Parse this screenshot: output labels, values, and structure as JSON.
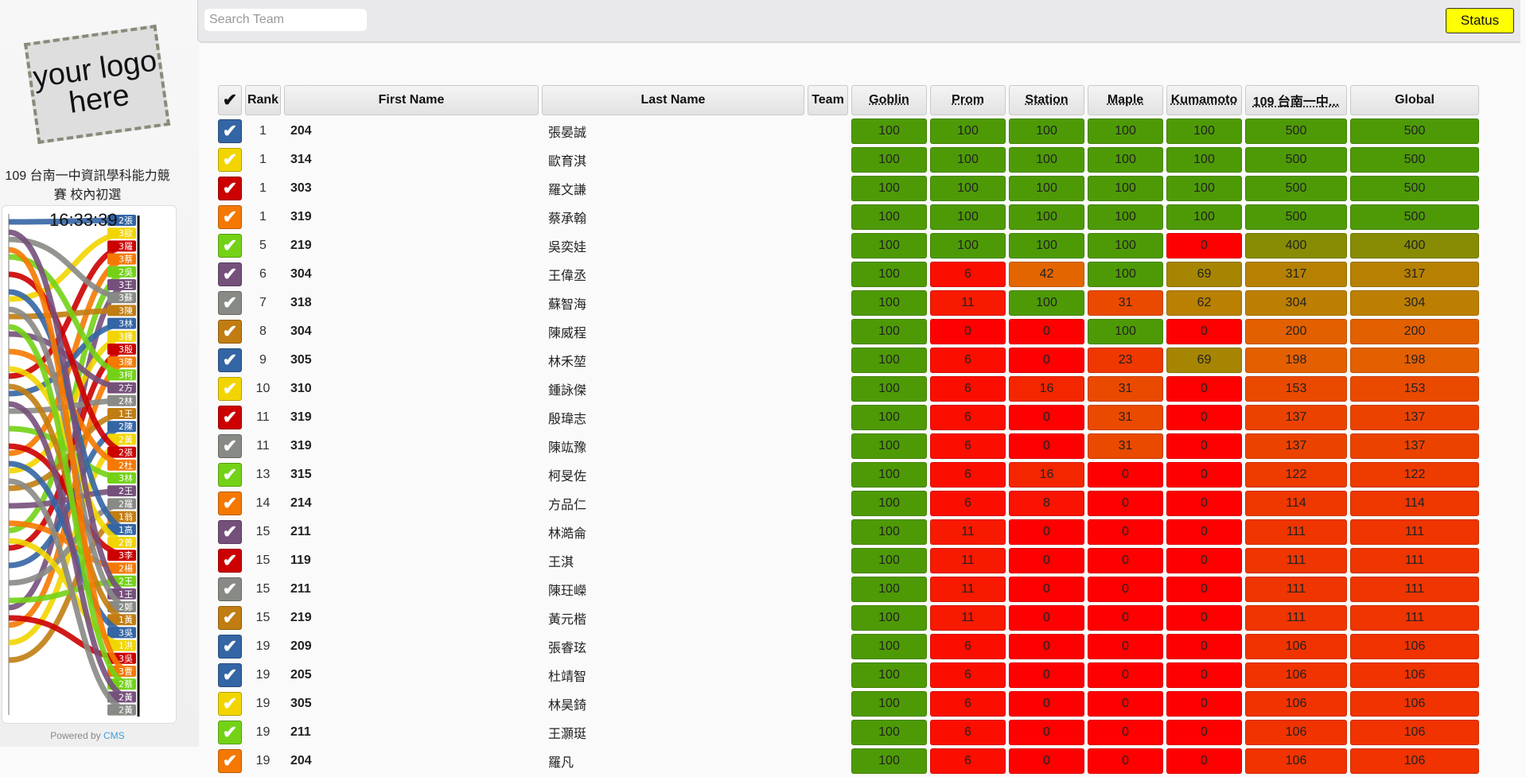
{
  "sidebar": {
    "logo_text": "your logo here",
    "contest_title": "109 台南一中資訊學科能力競賽 校內初選",
    "clock": "16:33:39",
    "powered_by": "Powered by",
    "powered_link": "CMS",
    "rank_chart_labels": [
      "2張",
      "3歐",
      "3羅",
      "3蔡",
      "2吳",
      "3王",
      "3蘇",
      "3陳",
      "3林",
      "3鍾",
      "3殷",
      "3陳",
      "3柯",
      "2方",
      "2林",
      "1王",
      "2陳",
      "2黃",
      "2張",
      "2杜",
      "3林",
      "2王",
      "2羅",
      "1翁",
      "1高",
      "2曾",
      "3李",
      "2楊",
      "2王",
      "1王",
      "2鄭",
      "1黃",
      "3吳",
      "1洪",
      "3吳",
      "3曹",
      "2蔡",
      "2黃",
      "2黃"
    ]
  },
  "topbar": {
    "search_placeholder": "Search Team",
    "status_label": "Status"
  },
  "colors": {
    "green": "#4e9a06",
    "red": "#ff0000",
    "status_yellow": "#ffff00",
    "team_colors": {
      "blue": "#3465a4",
      "yellow": "#f2d500",
      "red": "#cc0000",
      "orange": "#f57900",
      "lime": "#73d216",
      "purple": "#75507b",
      "gray": "#888a85",
      "brown": "#c17d11"
    }
  },
  "table": {
    "select_all_label": "✔",
    "headers": {
      "rank": "Rank",
      "first_name": "First Name",
      "last_name": "Last Name",
      "team": "Team",
      "tasks": [
        "Goblin",
        "Prom",
        "Station",
        "Maple",
        "Kumamoto"
      ],
      "contest": "109 台南一中...",
      "global": "Global"
    },
    "rows": [
      {
        "color": "blue",
        "rank": "1",
        "first": "204",
        "last": "張晏誠",
        "team": "",
        "scores": [
          "100",
          "100",
          "100",
          "100",
          "100"
        ],
        "contest": "500",
        "global": "500"
      },
      {
        "color": "yellow",
        "rank": "1",
        "first": "314",
        "last": "歐育淇",
        "team": "",
        "scores": [
          "100",
          "100",
          "100",
          "100",
          "100"
        ],
        "contest": "500",
        "global": "500"
      },
      {
        "color": "red",
        "rank": "1",
        "first": "303",
        "last": "羅文謙",
        "team": "",
        "scores": [
          "100",
          "100",
          "100",
          "100",
          "100"
        ],
        "contest": "500",
        "global": "500"
      },
      {
        "color": "orange",
        "rank": "1",
        "first": "319",
        "last": "蔡承翰",
        "team": "",
        "scores": [
          "100",
          "100",
          "100",
          "100",
          "100"
        ],
        "contest": "500",
        "global": "500"
      },
      {
        "color": "lime",
        "rank": "5",
        "first": "219",
        "last": "吳奕娃",
        "team": "",
        "scores": [
          "100",
          "100",
          "100",
          "100",
          "0"
        ],
        "contest": "400",
        "global": "400"
      },
      {
        "color": "purple",
        "rank": "6",
        "first": "304",
        "last": "王偉丞",
        "team": "",
        "scores": [
          "100",
          "6",
          "42",
          "100",
          "69"
        ],
        "contest": "317",
        "global": "317"
      },
      {
        "color": "gray",
        "rank": "7",
        "first": "318",
        "last": "蘇智海",
        "team": "",
        "scores": [
          "100",
          "11",
          "100",
          "31",
          "62"
        ],
        "contest": "304",
        "global": "304"
      },
      {
        "color": "brown",
        "rank": "8",
        "first": "304",
        "last": "陳威程",
        "team": "",
        "scores": [
          "100",
          "0",
          "0",
          "100",
          "0"
        ],
        "contest": "200",
        "global": "200"
      },
      {
        "color": "blue",
        "rank": "9",
        "first": "305",
        "last": "林禾堃",
        "team": "",
        "scores": [
          "100",
          "6",
          "0",
          "23",
          "69"
        ],
        "contest": "198",
        "global": "198"
      },
      {
        "color": "yellow",
        "rank": "10",
        "first": "310",
        "last": "鍾詠傑",
        "team": "",
        "scores": [
          "100",
          "6",
          "16",
          "31",
          "0"
        ],
        "contest": "153",
        "global": "153"
      },
      {
        "color": "red",
        "rank": "11",
        "first": "319",
        "last": "殷瑋志",
        "team": "",
        "scores": [
          "100",
          "6",
          "0",
          "31",
          "0"
        ],
        "contest": "137",
        "global": "137"
      },
      {
        "color": "gray",
        "rank": "11",
        "first": "319",
        "last": "陳竑豫",
        "team": "",
        "scores": [
          "100",
          "6",
          "0",
          "31",
          "0"
        ],
        "contest": "137",
        "global": "137"
      },
      {
        "color": "lime",
        "rank": "13",
        "first": "315",
        "last": "柯旻佐",
        "team": "",
        "scores": [
          "100",
          "6",
          "16",
          "0",
          "0"
        ],
        "contest": "122",
        "global": "122"
      },
      {
        "color": "orange",
        "rank": "14",
        "first": "214",
        "last": "方品仁",
        "team": "",
        "scores": [
          "100",
          "6",
          "8",
          "0",
          "0"
        ],
        "contest": "114",
        "global": "114"
      },
      {
        "color": "purple",
        "rank": "15",
        "first": "211",
        "last": "林澔侖",
        "team": "",
        "scores": [
          "100",
          "11",
          "0",
          "0",
          "0"
        ],
        "contest": "111",
        "global": "111"
      },
      {
        "color": "red",
        "rank": "15",
        "first": "119",
        "last": "王淇",
        "team": "",
        "scores": [
          "100",
          "11",
          "0",
          "0",
          "0"
        ],
        "contest": "111",
        "global": "111"
      },
      {
        "color": "gray",
        "rank": "15",
        "first": "211",
        "last": "陳玨嶸",
        "team": "",
        "scores": [
          "100",
          "11",
          "0",
          "0",
          "0"
        ],
        "contest": "111",
        "global": "111"
      },
      {
        "color": "brown",
        "rank": "15",
        "first": "219",
        "last": "黃元楷",
        "team": "",
        "scores": [
          "100",
          "11",
          "0",
          "0",
          "0"
        ],
        "contest": "111",
        "global": "111"
      },
      {
        "color": "blue",
        "rank": "19",
        "first": "209",
        "last": "張睿玹",
        "team": "",
        "scores": [
          "100",
          "6",
          "0",
          "0",
          "0"
        ],
        "contest": "106",
        "global": "106"
      },
      {
        "color": "blue",
        "rank": "19",
        "first": "205",
        "last": "杜靖智",
        "team": "",
        "scores": [
          "100",
          "6",
          "0",
          "0",
          "0"
        ],
        "contest": "106",
        "global": "106"
      },
      {
        "color": "yellow",
        "rank": "19",
        "first": "305",
        "last": "林昊錡",
        "team": "",
        "scores": [
          "100",
          "6",
          "0",
          "0",
          "0"
        ],
        "contest": "106",
        "global": "106"
      },
      {
        "color": "lime",
        "rank": "19",
        "first": "211",
        "last": "王灝珽",
        "team": "",
        "scores": [
          "100",
          "6",
          "0",
          "0",
          "0"
        ],
        "contest": "106",
        "global": "106"
      },
      {
        "color": "orange",
        "rank": "19",
        "first": "204",
        "last": "羅凡",
        "team": "",
        "scores": [
          "100",
          "6",
          "0",
          "0",
          "0"
        ],
        "contest": "106",
        "global": "106"
      }
    ]
  }
}
